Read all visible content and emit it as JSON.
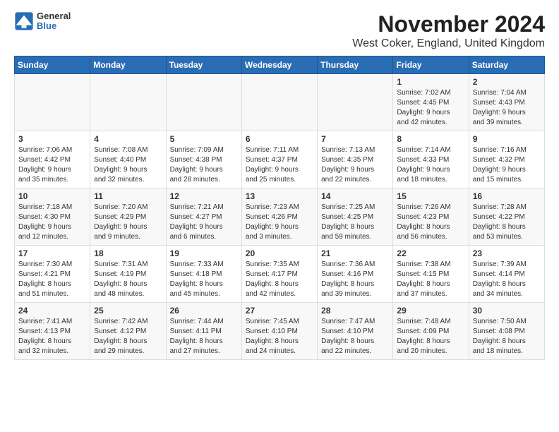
{
  "header": {
    "logo_general": "General",
    "logo_blue": "Blue",
    "title": "November 2024",
    "location": "West Coker, England, United Kingdom"
  },
  "weekdays": [
    "Sunday",
    "Monday",
    "Tuesday",
    "Wednesday",
    "Thursday",
    "Friday",
    "Saturday"
  ],
  "weeks": [
    [
      {
        "day": "",
        "info": ""
      },
      {
        "day": "",
        "info": ""
      },
      {
        "day": "",
        "info": ""
      },
      {
        "day": "",
        "info": ""
      },
      {
        "day": "",
        "info": ""
      },
      {
        "day": "1",
        "info": "Sunrise: 7:02 AM\nSunset: 4:45 PM\nDaylight: 9 hours\nand 42 minutes."
      },
      {
        "day": "2",
        "info": "Sunrise: 7:04 AM\nSunset: 4:43 PM\nDaylight: 9 hours\nand 39 minutes."
      }
    ],
    [
      {
        "day": "3",
        "info": "Sunrise: 7:06 AM\nSunset: 4:42 PM\nDaylight: 9 hours\nand 35 minutes."
      },
      {
        "day": "4",
        "info": "Sunrise: 7:08 AM\nSunset: 4:40 PM\nDaylight: 9 hours\nand 32 minutes."
      },
      {
        "day": "5",
        "info": "Sunrise: 7:09 AM\nSunset: 4:38 PM\nDaylight: 9 hours\nand 28 minutes."
      },
      {
        "day": "6",
        "info": "Sunrise: 7:11 AM\nSunset: 4:37 PM\nDaylight: 9 hours\nand 25 minutes."
      },
      {
        "day": "7",
        "info": "Sunrise: 7:13 AM\nSunset: 4:35 PM\nDaylight: 9 hours\nand 22 minutes."
      },
      {
        "day": "8",
        "info": "Sunrise: 7:14 AM\nSunset: 4:33 PM\nDaylight: 9 hours\nand 18 minutes."
      },
      {
        "day": "9",
        "info": "Sunrise: 7:16 AM\nSunset: 4:32 PM\nDaylight: 9 hours\nand 15 minutes."
      }
    ],
    [
      {
        "day": "10",
        "info": "Sunrise: 7:18 AM\nSunset: 4:30 PM\nDaylight: 9 hours\nand 12 minutes."
      },
      {
        "day": "11",
        "info": "Sunrise: 7:20 AM\nSunset: 4:29 PM\nDaylight: 9 hours\nand 9 minutes."
      },
      {
        "day": "12",
        "info": "Sunrise: 7:21 AM\nSunset: 4:27 PM\nDaylight: 9 hours\nand 6 minutes."
      },
      {
        "day": "13",
        "info": "Sunrise: 7:23 AM\nSunset: 4:26 PM\nDaylight: 9 hours\nand 3 minutes."
      },
      {
        "day": "14",
        "info": "Sunrise: 7:25 AM\nSunset: 4:25 PM\nDaylight: 8 hours\nand 59 minutes."
      },
      {
        "day": "15",
        "info": "Sunrise: 7:26 AM\nSunset: 4:23 PM\nDaylight: 8 hours\nand 56 minutes."
      },
      {
        "day": "16",
        "info": "Sunrise: 7:28 AM\nSunset: 4:22 PM\nDaylight: 8 hours\nand 53 minutes."
      }
    ],
    [
      {
        "day": "17",
        "info": "Sunrise: 7:30 AM\nSunset: 4:21 PM\nDaylight: 8 hours\nand 51 minutes."
      },
      {
        "day": "18",
        "info": "Sunrise: 7:31 AM\nSunset: 4:19 PM\nDaylight: 8 hours\nand 48 minutes."
      },
      {
        "day": "19",
        "info": "Sunrise: 7:33 AM\nSunset: 4:18 PM\nDaylight: 8 hours\nand 45 minutes."
      },
      {
        "day": "20",
        "info": "Sunrise: 7:35 AM\nSunset: 4:17 PM\nDaylight: 8 hours\nand 42 minutes."
      },
      {
        "day": "21",
        "info": "Sunrise: 7:36 AM\nSunset: 4:16 PM\nDaylight: 8 hours\nand 39 minutes."
      },
      {
        "day": "22",
        "info": "Sunrise: 7:38 AM\nSunset: 4:15 PM\nDaylight: 8 hours\nand 37 minutes."
      },
      {
        "day": "23",
        "info": "Sunrise: 7:39 AM\nSunset: 4:14 PM\nDaylight: 8 hours\nand 34 minutes."
      }
    ],
    [
      {
        "day": "24",
        "info": "Sunrise: 7:41 AM\nSunset: 4:13 PM\nDaylight: 8 hours\nand 32 minutes."
      },
      {
        "day": "25",
        "info": "Sunrise: 7:42 AM\nSunset: 4:12 PM\nDaylight: 8 hours\nand 29 minutes."
      },
      {
        "day": "26",
        "info": "Sunrise: 7:44 AM\nSunset: 4:11 PM\nDaylight: 8 hours\nand 27 minutes."
      },
      {
        "day": "27",
        "info": "Sunrise: 7:45 AM\nSunset: 4:10 PM\nDaylight: 8 hours\nand 24 minutes."
      },
      {
        "day": "28",
        "info": "Sunrise: 7:47 AM\nSunset: 4:10 PM\nDaylight: 8 hours\nand 22 minutes."
      },
      {
        "day": "29",
        "info": "Sunrise: 7:48 AM\nSunset: 4:09 PM\nDaylight: 8 hours\nand 20 minutes."
      },
      {
        "day": "30",
        "info": "Sunrise: 7:50 AM\nSunset: 4:08 PM\nDaylight: 8 hours\nand 18 minutes."
      }
    ]
  ]
}
